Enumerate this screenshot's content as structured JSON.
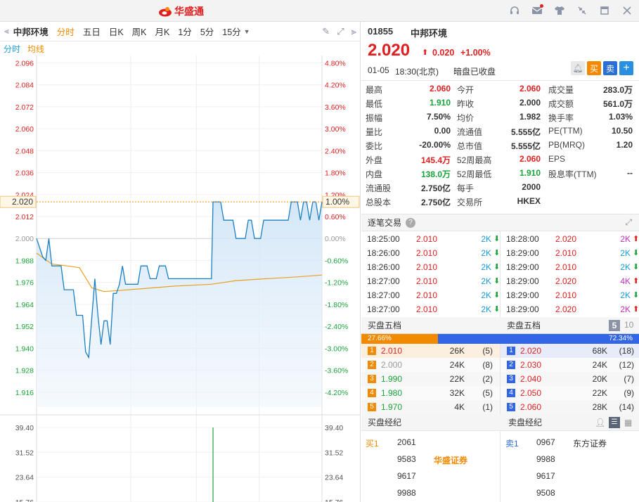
{
  "app": {
    "brand": "华盛通"
  },
  "colors": {
    "up": "#e02020",
    "down": "#1aa33a",
    "accent": "#f28a00",
    "price_line": "#1a7fc4",
    "avg_line": "#e8a020",
    "buy_bar": "#f28a00",
    "sell_bar": "#3366e6"
  },
  "toolbar": {
    "stock_name": "中邦环境",
    "periods": [
      "分时",
      "五日",
      "日K",
      "周K",
      "月K",
      "1分",
      "5分",
      "15分"
    ],
    "active_period": "分时"
  },
  "legend": {
    "series1": "分时",
    "series2": "均线"
  },
  "chart_data": {
    "type": "line",
    "prev_close": 2.0,
    "current": 2.02,
    "current_label": "2.020",
    "current_pct": "1.00%",
    "price_axis": [
      "2.096",
      "2.084",
      "2.072",
      "2.060",
      "2.048",
      "2.036",
      "2.024",
      "2.012",
      "2.000",
      "1.988",
      "1.976",
      "1.964",
      "1.952",
      "1.940",
      "1.928",
      "1.916"
    ],
    "pct_axis": [
      "4.80%",
      "4.20%",
      "3.60%",
      "3.00%",
      "2.40%",
      "1.80%",
      "1.20%",
      "0.60%",
      "0.00%",
      "-0.60%",
      "-1.20%",
      "-1.80%",
      "-2.40%",
      "-3.00%",
      "-3.60%",
      "-4.20%"
    ],
    "ylim": [
      1.904,
      2.1
    ],
    "price_series": [
      [
        0,
        2.0
      ],
      [
        2,
        1.99
      ],
      [
        3,
        1.988
      ],
      [
        4,
        2.0
      ],
      [
        5,
        1.985
      ],
      [
        8,
        1.985
      ],
      [
        9,
        1.972
      ],
      [
        12,
        1.972
      ],
      [
        13,
        1.958
      ],
      [
        15,
        1.958
      ],
      [
        16,
        1.938
      ],
      [
        17,
        1.935
      ],
      [
        19,
        1.978
      ],
      [
        20,
        1.958
      ],
      [
        21,
        1.942
      ],
      [
        22,
        1.955
      ],
      [
        23,
        1.955
      ],
      [
        24,
        1.942
      ],
      [
        25,
        1.97
      ],
      [
        26,
        1.97
      ],
      [
        27,
        1.975
      ],
      [
        28,
        1.985
      ],
      [
        29,
        1.975
      ],
      [
        33,
        1.975
      ],
      [
        34,
        1.985
      ],
      [
        36,
        1.985
      ],
      [
        37,
        1.978
      ],
      [
        39,
        1.978
      ],
      [
        40,
        1.985
      ],
      [
        42,
        1.985
      ],
      [
        43,
        1.978
      ],
      [
        57,
        1.978
      ],
      [
        57.5,
        2.02
      ],
      [
        60,
        2.02
      ],
      [
        61,
        2.01
      ],
      [
        64,
        2.01
      ],
      [
        65,
        2.0
      ],
      [
        68,
        2.0
      ],
      [
        69,
        2.01
      ],
      [
        70,
        2.01
      ],
      [
        71,
        2.0
      ],
      [
        73,
        2.0
      ],
      [
        74,
        2.01
      ],
      [
        82,
        2.01
      ],
      [
        83,
        2.02
      ],
      [
        85,
        2.02
      ],
      [
        86,
        2.01
      ],
      [
        87,
        2.02
      ],
      [
        88,
        2.02
      ],
      [
        89,
        2.01
      ],
      [
        90,
        2.02
      ],
      [
        91,
        2.02
      ],
      [
        92,
        2.01
      ],
      [
        93,
        2.02
      ]
    ],
    "avg_series": [
      [
        0,
        1.992
      ],
      [
        5,
        1.986
      ],
      [
        10,
        1.985
      ],
      [
        14,
        1.984
      ],
      [
        18,
        1.973
      ],
      [
        22,
        1.971
      ],
      [
        30,
        1.972
      ],
      [
        45,
        1.974
      ],
      [
        57,
        1.975
      ],
      [
        65,
        1.977
      ],
      [
        75,
        1.978
      ],
      [
        85,
        1.979
      ],
      [
        93,
        1.98
      ]
    ],
    "volume_axis": [
      "39.40",
      "31.52",
      "23.64",
      "15.76"
    ],
    "volume_max": 39.4,
    "volume_bars": [
      [
        3,
        3
      ],
      [
        22,
        4
      ],
      [
        57.5,
        39.4
      ]
    ]
  },
  "quote": {
    "code": "01855",
    "name": "中邦环境",
    "price": "2.020",
    "change": "0.020",
    "change_pct": "+1.00%",
    "date": "01-05",
    "time": "18:30(北京)",
    "status": "暗盘已收盘",
    "btn_buy": "买",
    "btn_sell": "卖",
    "btn_add": "+"
  },
  "stats": [
    [
      {
        "k": "最高",
        "v": "2.060",
        "c": "red"
      },
      {
        "k": "今开",
        "v": "2.060",
        "c": "red"
      },
      {
        "k": "成交量",
        "v": "283.0万",
        "c": ""
      }
    ],
    [
      {
        "k": "最低",
        "v": "1.910",
        "c": "green"
      },
      {
        "k": "昨收",
        "v": "2.000",
        "c": ""
      },
      {
        "k": "成交额",
        "v": "561.0万",
        "c": ""
      }
    ],
    [
      {
        "k": "振幅",
        "v": "7.50%",
        "c": ""
      },
      {
        "k": "均价",
        "v": "1.982",
        "c": ""
      },
      {
        "k": "换手率",
        "v": "1.03%",
        "c": ""
      }
    ],
    [
      {
        "k": "量比",
        "v": "0.00",
        "c": ""
      },
      {
        "k": "流通值",
        "v": "5.555亿",
        "c": ""
      },
      {
        "k": "PE(TTM)",
        "v": "10.50",
        "c": ""
      }
    ],
    [
      {
        "k": "委比",
        "v": "-20.00%",
        "c": ""
      },
      {
        "k": "总市值",
        "v": "5.555亿",
        "c": ""
      },
      {
        "k": "PB(MRQ)",
        "v": "1.20",
        "c": ""
      }
    ],
    [
      {
        "k": "外盘",
        "v": "145.4万",
        "c": "red"
      },
      {
        "k": "52周最高",
        "v": "2.060",
        "c": "red"
      },
      {
        "k": "EPS",
        "v": "",
        "c": ""
      }
    ],
    [
      {
        "k": "内盘",
        "v": "138.0万",
        "c": "green"
      },
      {
        "k": "52周最低",
        "v": "1.910",
        "c": "green"
      },
      {
        "k": "股息率(TTM)",
        "v": "--",
        "c": ""
      }
    ],
    [
      {
        "k": "流通股",
        "v": "2.750亿",
        "c": ""
      },
      {
        "k": "每手",
        "v": "2000",
        "c": ""
      },
      {
        "k": "",
        "v": "",
        "c": ""
      }
    ],
    [
      {
        "k": "总股本",
        "v": "2.750亿",
        "c": ""
      },
      {
        "k": "交易所",
        "v": "HKEX",
        "c": ""
      },
      {
        "k": "",
        "v": "",
        "c": ""
      }
    ]
  ],
  "ticks": {
    "title": "逐笔交易",
    "left": [
      {
        "t": "18:25:00",
        "p": "2.010",
        "v": "2K",
        "d": "down"
      },
      {
        "t": "18:26:00",
        "p": "2.010",
        "v": "2K",
        "d": "down"
      },
      {
        "t": "18:26:00",
        "p": "2.010",
        "v": "2K",
        "d": "down"
      },
      {
        "t": "18:27:00",
        "p": "2.010",
        "v": "2K",
        "d": "down"
      },
      {
        "t": "18:27:00",
        "p": "2.010",
        "v": "2K",
        "d": "down"
      },
      {
        "t": "18:27:00",
        "p": "2.010",
        "v": "2K",
        "d": "down"
      }
    ],
    "right": [
      {
        "t": "18:28:00",
        "p": "2.020",
        "v": "2K",
        "d": "up"
      },
      {
        "t": "18:29:00",
        "p": "2.010",
        "v": "2K",
        "d": "down"
      },
      {
        "t": "18:29:00",
        "p": "2.010",
        "v": "2K",
        "d": "down"
      },
      {
        "t": "18:29:00",
        "p": "2.020",
        "v": "4K",
        "d": "up"
      },
      {
        "t": "18:29:00",
        "p": "2.010",
        "v": "2K",
        "d": "down"
      },
      {
        "t": "18:29:00",
        "p": "2.020",
        "v": "2K",
        "d": "up"
      }
    ]
  },
  "book": {
    "bid_title": "买盘五档",
    "ask_title": "卖盘五档",
    "depth_5": "5",
    "depth_10": "10",
    "bid_ratio": "27.66%",
    "ask_ratio": "72.34%",
    "bid_fraction": 0.2766,
    "bids": [
      {
        "lvl": "1",
        "p": "2.010",
        "v": "26K",
        "n": "(5)",
        "c": "red"
      },
      {
        "lvl": "2",
        "p": "2.000",
        "v": "24K",
        "n": "(8)",
        "c": "gray"
      },
      {
        "lvl": "3",
        "p": "1.990",
        "v": "22K",
        "n": "(2)",
        "c": "green"
      },
      {
        "lvl": "4",
        "p": "1.980",
        "v": "32K",
        "n": "(5)",
        "c": "green"
      },
      {
        "lvl": "5",
        "p": "1.970",
        "v": "4K",
        "n": "(1)",
        "c": "green"
      }
    ],
    "asks": [
      {
        "lvl": "1",
        "p": "2.020",
        "v": "68K",
        "n": "(18)",
        "c": "red"
      },
      {
        "lvl": "2",
        "p": "2.030",
        "v": "24K",
        "n": "(12)",
        "c": "red"
      },
      {
        "lvl": "3",
        "p": "2.040",
        "v": "20K",
        "n": "(7)",
        "c": "red"
      },
      {
        "lvl": "4",
        "p": "2.050",
        "v": "22K",
        "n": "(9)",
        "c": "red"
      },
      {
        "lvl": "5",
        "p": "2.060",
        "v": "28K",
        "n": "(14)",
        "c": "red"
      }
    ]
  },
  "brokers": {
    "bid_title": "买盘经纪",
    "ask_title": "卖盘经纪",
    "bid_label": "买1",
    "ask_label": "卖1",
    "bid_ids": [
      "2061",
      "9583",
      "9617",
      "9988"
    ],
    "bid_name": "华盛证券",
    "ask_ids": [
      "0967",
      "9988",
      "9617",
      "9508"
    ],
    "ask_name": "东方证券"
  }
}
